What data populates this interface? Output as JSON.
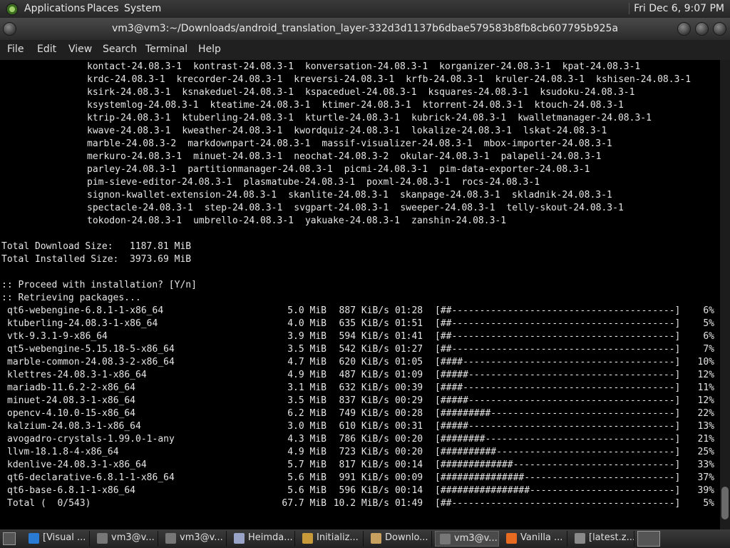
{
  "top_panel": {
    "menus": [
      "Applications",
      "Places",
      "System"
    ],
    "clock": "Fri Dec 6,  9:07 PM"
  },
  "window": {
    "title": "vm3@vm3:~/Downloads/android_translation_layer-332d3d1137b6dbae579583b8fb8cb607795b925a"
  },
  "menubar": [
    "File",
    "Edit",
    "View",
    "Search",
    "Terminal",
    "Help"
  ],
  "terminal": {
    "package_lines": [
      [
        "kontact-24.08.3-1",
        "kontrast-24.08.3-1",
        "konversation-24.08.3-1",
        "korganizer-24.08.3-1",
        "kpat-24.08.3-1"
      ],
      [
        "krdc-24.08.3-1",
        "krecorder-24.08.3-1",
        "kreversi-24.08.3-1",
        "krfb-24.08.3-1",
        "kruler-24.08.3-1",
        "kshisen-24.08.3-1"
      ],
      [
        "ksirk-24.08.3-1",
        "ksnakeduel-24.08.3-1",
        "kspaceduel-24.08.3-1",
        "ksquares-24.08.3-1",
        "ksudoku-24.08.3-1"
      ],
      [
        "ksystemlog-24.08.3-1",
        "kteatime-24.08.3-1",
        "ktimer-24.08.3-1",
        "ktorrent-24.08.3-1",
        "ktouch-24.08.3-1"
      ],
      [
        "ktrip-24.08.3-1",
        "ktuberling-24.08.3-1",
        "kturtle-24.08.3-1",
        "kubrick-24.08.3-1",
        "kwalletmanager-24.08.3-1"
      ],
      [
        "kwave-24.08.3-1",
        "kweather-24.08.3-1",
        "kwordquiz-24.08.3-1",
        "lokalize-24.08.3-1",
        "lskat-24.08.3-1"
      ],
      [
        "marble-24.08.3-2",
        "markdownpart-24.08.3-1",
        "massif-visualizer-24.08.3-1",
        "mbox-importer-24.08.3-1"
      ],
      [
        "merkuro-24.08.3-1",
        "minuet-24.08.3-1",
        "neochat-24.08.3-2",
        "okular-24.08.3-1",
        "palapeli-24.08.3-1"
      ],
      [
        "parley-24.08.3-1",
        "partitionmanager-24.08.3-1",
        "picmi-24.08.3-1",
        "pim-data-exporter-24.08.3-1"
      ],
      [
        "pim-sieve-editor-24.08.3-1",
        "plasmatube-24.08.3-1",
        "poxml-24.08.3-1",
        "rocs-24.08.3-1"
      ],
      [
        "signon-kwallet-extension-24.08.3-1",
        "skanlite-24.08.3-1",
        "skanpage-24.08.3-1",
        "skladnik-24.08.3-1"
      ],
      [
        "spectacle-24.08.3-1",
        "step-24.08.3-1",
        "svgpart-24.08.3-1",
        "sweeper-24.08.3-1",
        "telly-skout-24.08.3-1"
      ],
      [
        "tokodon-24.08.3-1",
        "umbrello-24.08.3-1",
        "yakuake-24.08.3-1",
        "zanshin-24.08.3-1"
      ]
    ],
    "total_download": "Total Download Size:   1187.81 MiB",
    "total_installed": "Total Installed Size:  3973.69 MiB",
    "proceed": ":: Proceed with installation? [Y/n]",
    "retrieving": ":: Retrieving packages...",
    "downloads": [
      {
        "name": "qt6-webengine-6.8.1-1-x86_64",
        "size": "5.0 MiB",
        "speed": "887 KiB/s",
        "eta": "01:28",
        "bar": "[##----------------------------------------]",
        "pct": "6%"
      },
      {
        "name": "ktuberling-24.08.3-1-x86_64",
        "size": "4.0 MiB",
        "speed": "635 KiB/s",
        "eta": "01:51",
        "bar": "[##----------------------------------------]",
        "pct": "5%"
      },
      {
        "name": "vtk-9.3.1-9-x86_64",
        "size": "3.9 MiB",
        "speed": "594 KiB/s",
        "eta": "01:41",
        "bar": "[##----------------------------------------]",
        "pct": "6%"
      },
      {
        "name": "qt5-webengine-5.15.18-5-x86_64",
        "size": "3.5 MiB",
        "speed": "542 KiB/s",
        "eta": "01:27",
        "bar": "[##----------------------------------------]",
        "pct": "7%"
      },
      {
        "name": "marble-common-24.08.3-2-x86_64",
        "size": "4.7 MiB",
        "speed": "620 KiB/s",
        "eta": "01:05",
        "bar": "[####--------------------------------------]",
        "pct": "10%"
      },
      {
        "name": "klettres-24.08.3-1-x86_64",
        "size": "4.9 MiB",
        "speed": "487 KiB/s",
        "eta": "01:09",
        "bar": "[#####-------------------------------------]",
        "pct": "12%"
      },
      {
        "name": "mariadb-11.6.2-2-x86_64",
        "size": "3.1 MiB",
        "speed": "632 KiB/s",
        "eta": "00:39",
        "bar": "[####--------------------------------------]",
        "pct": "11%"
      },
      {
        "name": "minuet-24.08.3-1-x86_64",
        "size": "3.5 MiB",
        "speed": "837 KiB/s",
        "eta": "00:29",
        "bar": "[#####-------------------------------------]",
        "pct": "12%"
      },
      {
        "name": "opencv-4.10.0-15-x86_64",
        "size": "6.2 MiB",
        "speed": "749 KiB/s",
        "eta": "00:28",
        "bar": "[#########---------------------------------]",
        "pct": "22%"
      },
      {
        "name": "kalzium-24.08.3-1-x86_64",
        "size": "3.0 MiB",
        "speed": "610 KiB/s",
        "eta": "00:31",
        "bar": "[#####-------------------------------------]",
        "pct": "13%"
      },
      {
        "name": "avogadro-crystals-1.99.0-1-any",
        "size": "4.3 MiB",
        "speed": "786 KiB/s",
        "eta": "00:20",
        "bar": "[########----------------------------------]",
        "pct": "21%"
      },
      {
        "name": "llvm-18.1.8-4-x86_64",
        "size": "4.9 MiB",
        "speed": "723 KiB/s",
        "eta": "00:20",
        "bar": "[##########--------------------------------]",
        "pct": "25%"
      },
      {
        "name": "kdenlive-24.08.3-1-x86_64",
        "size": "5.7 MiB",
        "speed": "817 KiB/s",
        "eta": "00:14",
        "bar": "[#############-----------------------------]",
        "pct": "33%"
      },
      {
        "name": "qt6-declarative-6.8.1-1-x86_64",
        "size": "5.6 MiB",
        "speed": "991 KiB/s",
        "eta": "00:09",
        "bar": "[###############---------------------------]",
        "pct": "37%"
      },
      {
        "name": "qt6-base-6.8.1-1-x86_64",
        "size": "5.6 MiB",
        "speed": "596 KiB/s",
        "eta": "00:14",
        "bar": "[################--------------------------]",
        "pct": "39%"
      },
      {
        "name": "Total (  0/543)",
        "size": "67.7 MiB",
        "speed": "10.2 MiB/s",
        "eta": "01:49",
        "bar": "[##----------------------------------------]",
        "pct": "5%"
      }
    ]
  },
  "taskbar": {
    "tasks": [
      {
        "label": "[Visual ...",
        "icon": "vscode-icon",
        "color": "#2a7bd4"
      },
      {
        "label": "vm3@v...",
        "icon": "terminal-icon",
        "color": "#777777"
      },
      {
        "label": "vm3@v...",
        "icon": "terminal-icon",
        "color": "#777777"
      },
      {
        "label": "Heimda...",
        "icon": "file-manager-icon",
        "color": "#9aa4c8"
      },
      {
        "label": "Initializ...",
        "icon": "gimp-icon",
        "color": "#c99a3a"
      },
      {
        "label": "Downlo...",
        "icon": "folder-icon",
        "color": "#c8a060"
      },
      {
        "label": "vm3@v...",
        "icon": "terminal-icon",
        "color": "#777777",
        "active": true
      },
      {
        "label": "Vanilla ...",
        "icon": "firefox-icon",
        "color": "#e66a1f"
      },
      {
        "label": "[latest.z...",
        "icon": "archive-icon",
        "color": "#8a8a8a"
      }
    ]
  }
}
